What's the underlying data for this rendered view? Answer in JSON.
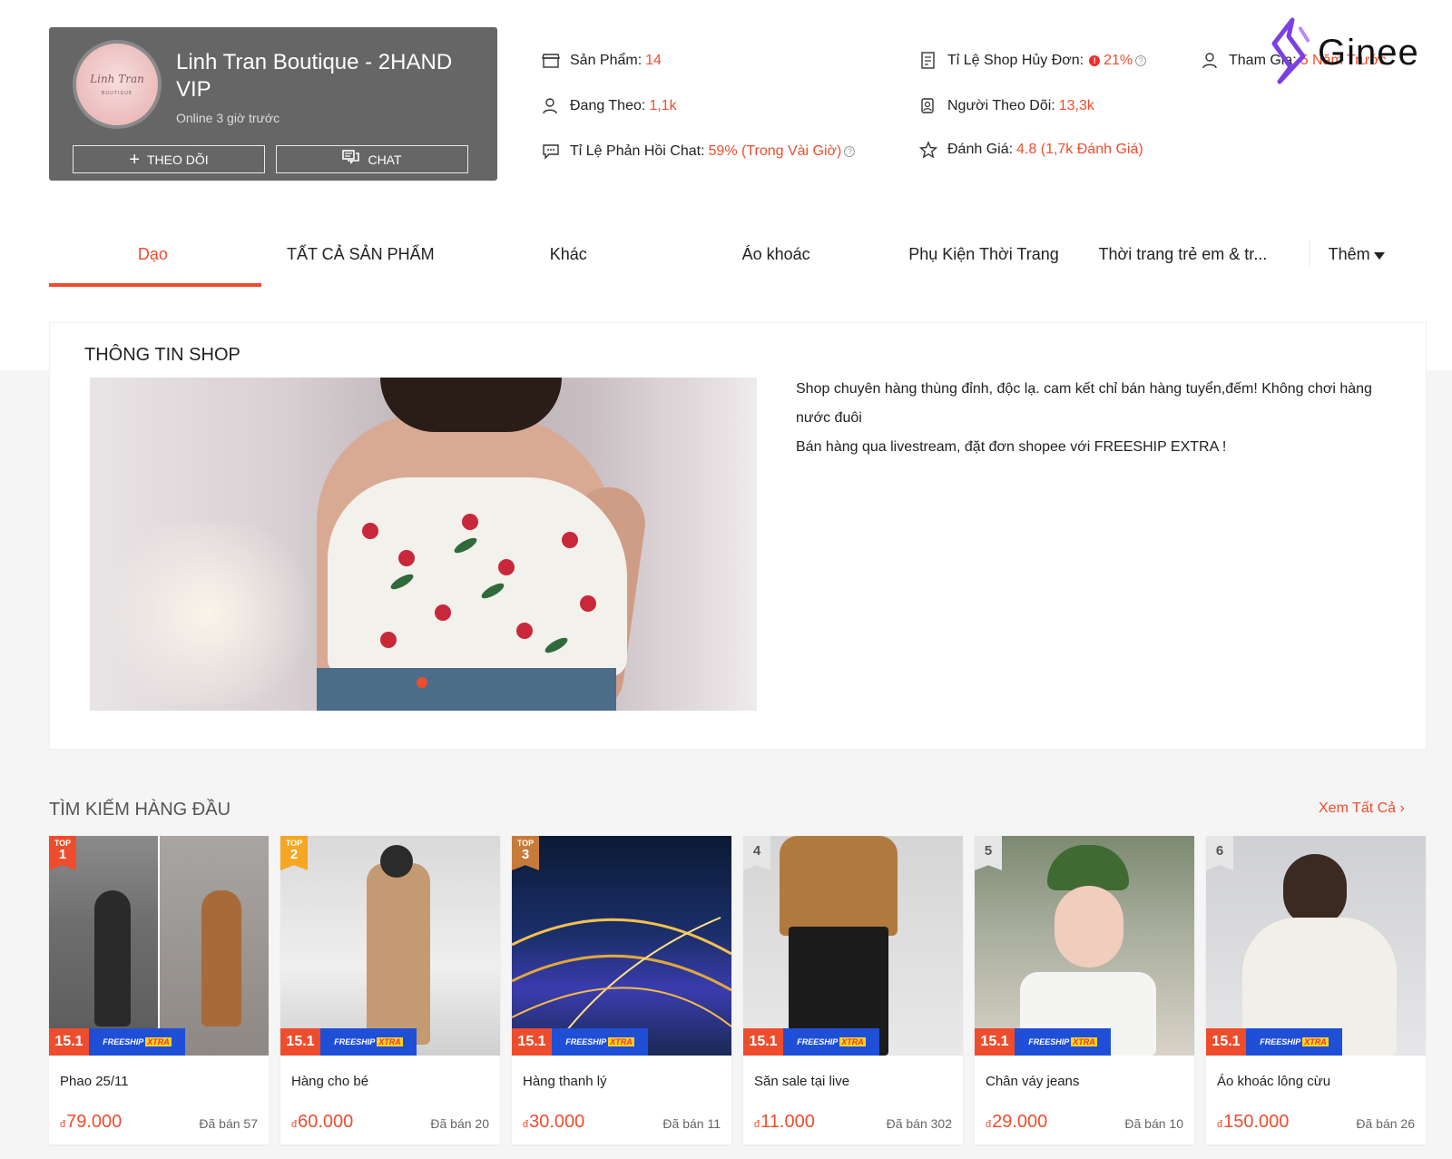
{
  "shop": {
    "name": "Linh Tran Boutique - 2HAND VIP",
    "online": "Online 3 giờ trước",
    "follow_label": "THEO DÕI",
    "chat_label": "CHAT",
    "avatar_script": "Linh Tran",
    "avatar_sub": "BOUTIQUE"
  },
  "stats": {
    "products_label": "Sản Phẩm:",
    "products_value": "14",
    "following_label": "Đang Theo:",
    "following_value": "1,1k",
    "chat_rate_label": "Tỉ Lệ Phản Hồi Chat:",
    "chat_rate_value": "59% (Trong Vài Giờ)",
    "cancel_label": "Tỉ Lệ Shop Hủy Đơn:",
    "cancel_value": "21%",
    "followers_label": "Người Theo Dõi:",
    "followers_value": "13,3k",
    "rating_label": "Đánh Giá:",
    "rating_value": "4.8 (1,7k Đánh Giá)",
    "joined_label": "Tham Gia:",
    "joined_value": "5 Năm Trước"
  },
  "brand": {
    "name": "Ginee",
    "color": "#7b3fe4"
  },
  "tabs": [
    {
      "label": "Dạo",
      "active": true
    },
    {
      "label": "TẤT CẢ SẢN PHẨM",
      "active": false
    },
    {
      "label": "Khác",
      "active": false
    },
    {
      "label": "Áo khoác",
      "active": false
    },
    {
      "label": "Phụ Kiện Thời Trang",
      "active": false
    },
    {
      "label": "Thời trang trẻ em & tr...",
      "active": false
    }
  ],
  "tab_more": "Thêm",
  "info": {
    "title": "THÔNG TIN SHOP",
    "desc_line1": "Shop chuyên hàng thùng đỉnh, độc lạ. cam kết chỉ bán hàng tuyển,đếm! Không chơi hàng nước đuôi",
    "desc_line2": "Bán hàng qua livestream, đặt đơn shopee với FREESHIP EXTRA !"
  },
  "top_search": {
    "title": "TÌM KIẾM HÀNG ĐẦU",
    "see_all": "Xem Tất Cả"
  },
  "promo": {
    "date": "15.1",
    "freeship": "FREESHIP",
    "xtra": "XTRA"
  },
  "products": [
    {
      "rank_top": "TOP",
      "rank": "1",
      "name": "Phao 25/11",
      "currency": "đ",
      "price": "79.000",
      "sold": "Đã bán 57"
    },
    {
      "rank_top": "TOP",
      "rank": "2",
      "name": "Hàng cho bé",
      "currency": "đ",
      "price": "60.000",
      "sold": "Đã bán 20"
    },
    {
      "rank_top": "TOP",
      "rank": "3",
      "name": "Hàng thanh lý",
      "currency": "đ",
      "price": "30.000",
      "sold": "Đã bán 11"
    },
    {
      "rank_top": "",
      "rank": "4",
      "name": "Săn sale tại live",
      "currency": "đ",
      "price": "11.000",
      "sold": "Đã bán 302"
    },
    {
      "rank_top": "",
      "rank": "5",
      "name": "Chân váy jeans",
      "currency": "đ",
      "price": "29.000",
      "sold": "Đã bán 10"
    },
    {
      "rank_top": "",
      "rank": "6",
      "name": "Áo khoác lông cừu",
      "currency": "đ",
      "price": "150.000",
      "sold": "Đã bán 26"
    }
  ],
  "colors": {
    "accent": "#ee4d2d",
    "card_bg": "#666666",
    "freeship_blue": "#1f4fd6"
  }
}
